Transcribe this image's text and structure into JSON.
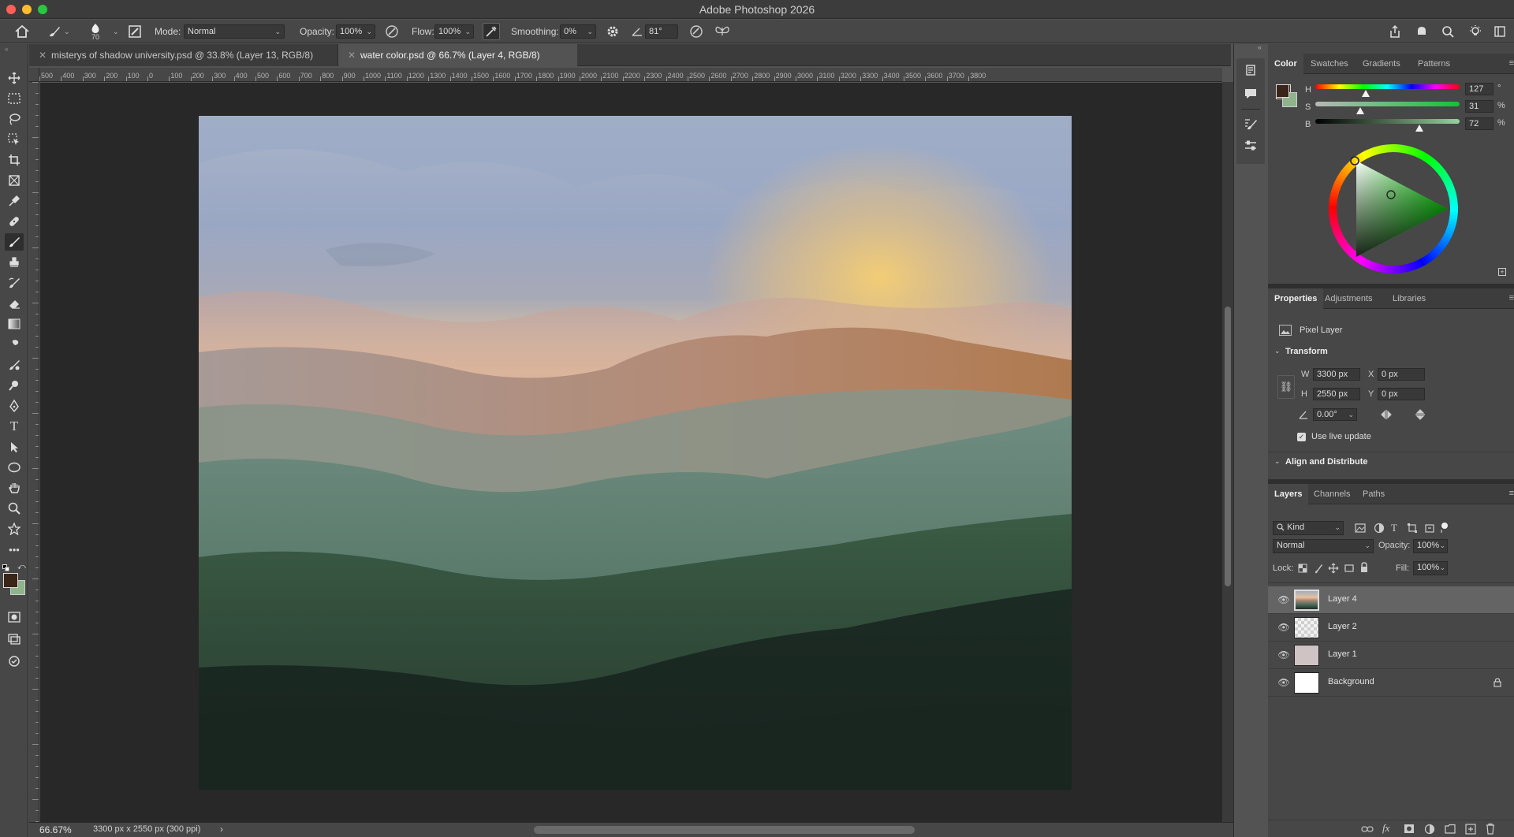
{
  "app": {
    "title": "Adobe Photoshop 2026"
  },
  "options": {
    "brush_size": "70",
    "mode_label": "Mode:",
    "mode_value": "Normal",
    "opacity_label": "Opacity:",
    "opacity_value": "100%",
    "flow_label": "Flow:",
    "flow_value": "100%",
    "smoothing_label": "Smoothing:",
    "smoothing_value": "0%",
    "angle_value": "81°"
  },
  "tabs": [
    {
      "label": "misterys of shadow university.psd @ 33.8% (Layer 13, RGB/8)"
    },
    {
      "label": "water color.psd @ 66.7% (Layer 4, RGB/8)"
    }
  ],
  "ruler": {
    "h_ticks": [
      "500",
      "400",
      "300",
      "200",
      "100",
      "0",
      "100",
      "200",
      "300",
      "400",
      "500",
      "600",
      "700",
      "800",
      "900",
      "1000",
      "1100",
      "1200",
      "1300",
      "1400",
      "1500",
      "1600",
      "1700",
      "1800",
      "1900",
      "2000",
      "2100",
      "2200",
      "2300",
      "2400",
      "2500",
      "2600",
      "2700",
      "2800",
      "2900",
      "3000",
      "3100",
      "3200",
      "3300",
      "3400",
      "3500",
      "3600",
      "3700",
      "3800"
    ]
  },
  "status": {
    "zoom": "66.67%",
    "doc_info": "3300 px x 2550 px (300 ppi)",
    "arrow": "›"
  },
  "colors": {
    "foreground": "#3b2418",
    "background": "#8fb48c",
    "accent": "#1473e6"
  },
  "color_panel": {
    "tabs": [
      "Color",
      "Swatches",
      "Gradients",
      "Patterns"
    ],
    "h_label": "H",
    "h_value": "127",
    "h_unit": "°",
    "h_level": 0.35,
    "s_label": "S",
    "s_value": "31",
    "s_unit": "%",
    "s_level": 0.31,
    "b_label": "B",
    "b_value": "72",
    "b_unit": "%",
    "b_level": 0.72
  },
  "properties": {
    "tabs": [
      "Properties",
      "Adjustments",
      "Libraries"
    ],
    "layer_type": "Pixel Layer",
    "transform_heading": "Transform",
    "w_label": "W",
    "w_value": "3300 px",
    "h_label": "H",
    "h_value": "2550 px",
    "x_label": "X",
    "x_value": "0 px",
    "y_label": "Y",
    "y_value": "0 px",
    "angle_value": "0.00°",
    "live_update": "Use live update",
    "align_heading": "Align and Distribute"
  },
  "layers_panel": {
    "tabs": [
      "Layers",
      "Channels",
      "Paths"
    ],
    "kind_label": "Kind",
    "blend_mode": "Normal",
    "opacity_label": "Opacity:",
    "opacity_value": "100%",
    "lock_label": "Lock:",
    "fill_label": "Fill:",
    "fill_value": "100%",
    "layers": [
      {
        "name": "Layer 4"
      },
      {
        "name": "Layer 2"
      },
      {
        "name": "Layer 1"
      },
      {
        "name": "Background"
      }
    ]
  }
}
